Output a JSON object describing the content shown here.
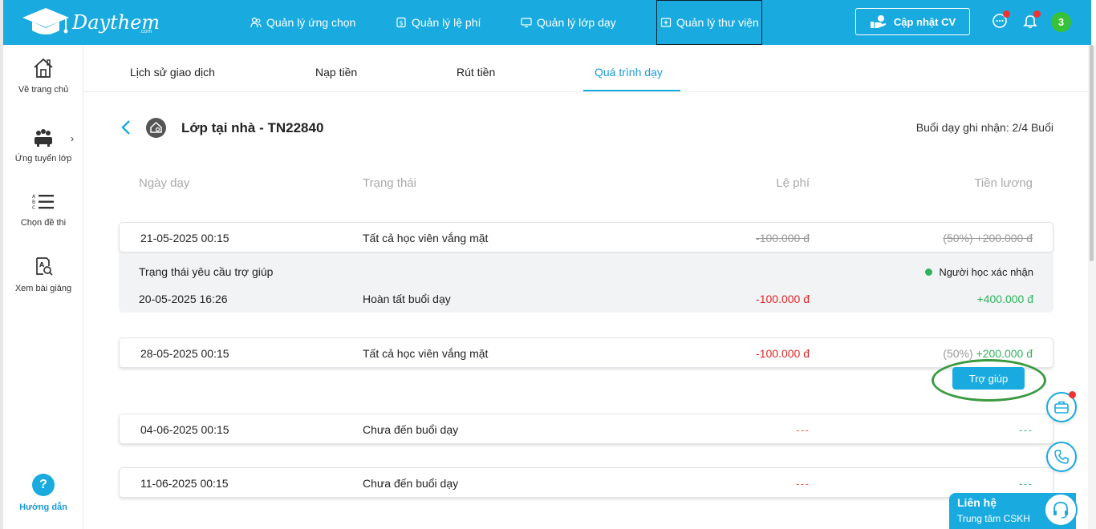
{
  "header": {
    "logo_text": "Daythem",
    "logo_suffix": ".com",
    "nav": [
      {
        "label": "Quản lý ứng chọn",
        "icon": "users-icon"
      },
      {
        "label": "Quản lý lệ phí",
        "icon": "fee-icon"
      },
      {
        "label": "Quản lý lớp dạy",
        "icon": "monitor-icon"
      },
      {
        "label": "Quản lý thư viện",
        "icon": "library-icon"
      }
    ],
    "update_cv_label": "Cập nhật CV",
    "avatar_label": "3"
  },
  "sidebar": {
    "items": [
      {
        "label": "Về trang chủ",
        "icon": "home-icon"
      },
      {
        "label": "Ứng tuyển lớp",
        "icon": "group-icon"
      },
      {
        "label": "Chọn đề thi",
        "icon": "abc-list-icon"
      },
      {
        "label": "Xem bài giảng",
        "icon": "lesson-icon"
      }
    ],
    "expand_icon": "›",
    "help_label": "Hướng dẫn",
    "help_icon": "?"
  },
  "tabs": [
    {
      "label": "Lịch sử giao dịch"
    },
    {
      "label": "Nạp tiền"
    },
    {
      "label": "Rút tiền"
    },
    {
      "label": "Quá trình dạy",
      "active": true
    }
  ],
  "class_info": {
    "title": "Lớp tại nhà - TN22840",
    "record_text": "Buổi dạy ghi nhận: 2/4 Buổi"
  },
  "columns": [
    "Ngày dạy",
    "Trạng thái",
    "Lệ phí",
    "Tiền lương"
  ],
  "sessions": [
    {
      "date": "21-05-2025 00:15",
      "status": "Tất cả học viên vắng mặt",
      "fee": "-100.000 đ",
      "salary": "(50%) +200.000 đ"
    },
    {
      "date": "28-05-2025 00:15",
      "status": "Tất cả học viên vắng mặt",
      "fee": "-100.000 đ",
      "salary_pct": "(50%)",
      "salary_amount": "+200.000 đ"
    },
    {
      "date": "04-06-2025 00:15",
      "status": "Chưa đến buổi dạy",
      "fee": "---",
      "salary": "---"
    },
    {
      "date": "11-06-2025 00:15",
      "status": "Chưa đến buổi dạy",
      "fee": "---",
      "salary": "---"
    }
  ],
  "help_request": {
    "label": "Trạng thái yêu cầu trợ giúp",
    "badge": "Người học xác nhận",
    "date": "20-05-2025 16:26",
    "status": "Hoàn tất buổi dạy",
    "fee": "-100.000 đ",
    "salary": "+400.000 đ"
  },
  "help_button_label": "Trợ giúp",
  "contact": {
    "title": "Liên hệ",
    "subtitle": "Trung tâm CSKH"
  },
  "colors": {
    "primary": "#19abe0",
    "negative": "#e02525",
    "positive": "#2fb35c",
    "highlight_oval": "#3a9a40"
  }
}
